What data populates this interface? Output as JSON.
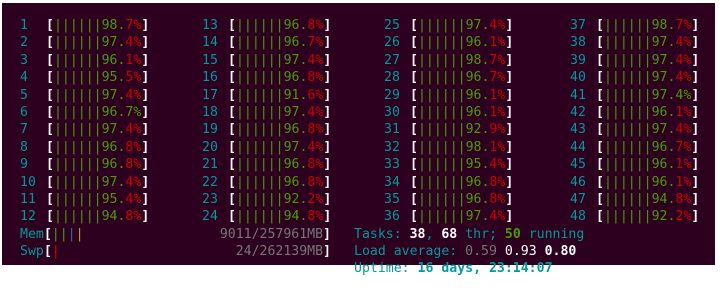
{
  "cpus": [
    {
      "n": "1",
      "bars": "||||||",
      "int": "98.",
      "dec": "7",
      "dec_color": "red"
    },
    {
      "n": "13",
      "bars": "||||||",
      "int": "96.",
      "dec": "8",
      "dec_color": "red"
    },
    {
      "n": "25",
      "bars": "||||||",
      "int": "97.",
      "dec": "4",
      "dec_color": "red"
    },
    {
      "n": "37",
      "bars": "||||||",
      "int": "98.",
      "dec": "7",
      "dec_color": "red"
    },
    {
      "n": "2",
      "bars": "||||||",
      "int": "97.",
      "dec": "4",
      "dec_color": "red"
    },
    {
      "n": "14",
      "bars": "||||||",
      "int": "96.",
      "dec": "7",
      "dec_color": "red"
    },
    {
      "n": "26",
      "bars": "||||||",
      "int": "96.",
      "dec": "1",
      "dec_color": "red"
    },
    {
      "n": "38",
      "bars": "||||||",
      "int": "97.",
      "dec": "4",
      "dec_color": "red"
    },
    {
      "n": "3",
      "bars": "||||||",
      "int": "96.",
      "dec": "1",
      "dec_color": "red"
    },
    {
      "n": "15",
      "bars": "||||||",
      "int": "97.",
      "dec": "4",
      "dec_color": "red"
    },
    {
      "n": "27",
      "bars": "||||||",
      "int": "98.",
      "dec": "7",
      "dec_color": "red"
    },
    {
      "n": "39",
      "bars": "||||||",
      "int": "97.",
      "dec": "4",
      "dec_color": "red"
    },
    {
      "n": "4",
      "bars": "||||||",
      "int": "95.",
      "dec": "5",
      "dec_color": "red"
    },
    {
      "n": "16",
      "bars": "||||||",
      "int": "96.",
      "dec": "8",
      "dec_color": "red"
    },
    {
      "n": "28",
      "bars": "||||||",
      "int": "96.",
      "dec": "7",
      "dec_color": "red"
    },
    {
      "n": "40",
      "bars": "||||||",
      "int": "97.",
      "dec": "4",
      "dec_color": "red"
    },
    {
      "n": "5",
      "bars": "||||||",
      "int": "97.",
      "dec": "4",
      "dec_color": "red"
    },
    {
      "n": "17",
      "bars": "||||||",
      "int": "91.",
      "dec": "6",
      "dec_color": "red"
    },
    {
      "n": "29",
      "bars": "||||||",
      "int": "96.",
      "dec": "1",
      "dec_color": "red"
    },
    {
      "n": "41",
      "bars": "||||||",
      "int": "97.",
      "dec": "4",
      "dec_color": "green"
    },
    {
      "n": "6",
      "bars": "||||||",
      "int": "96.",
      "dec": "7",
      "dec_color": "green"
    },
    {
      "n": "18",
      "bars": "||||||",
      "int": "97.",
      "dec": "4",
      "dec_color": "red"
    },
    {
      "n": "30",
      "bars": "||||||",
      "int": "96.",
      "dec": "1",
      "dec_color": "red"
    },
    {
      "n": "42",
      "bars": "||||||",
      "int": "96.",
      "dec": "1",
      "dec_color": "red"
    },
    {
      "n": "7",
      "bars": "||||||",
      "int": "97.",
      "dec": "4",
      "dec_color": "red"
    },
    {
      "n": "19",
      "bars": "||||||",
      "int": "96.",
      "dec": "8",
      "dec_color": "red"
    },
    {
      "n": "31",
      "bars": "||||||",
      "int": "92.",
      "dec": "9",
      "dec_color": "red"
    },
    {
      "n": "43",
      "bars": "||||||",
      "int": "97.",
      "dec": "4",
      "dec_color": "red"
    },
    {
      "n": "8",
      "bars": "||||||",
      "int": "96.",
      "dec": "8",
      "dec_color": "red"
    },
    {
      "n": "20",
      "bars": "||||||",
      "int": "97.",
      "dec": "4",
      "dec_color": "red"
    },
    {
      "n": "32",
      "bars": "||||||",
      "int": "98.",
      "dec": "1",
      "dec_color": "red"
    },
    {
      "n": "44",
      "bars": "||||||",
      "int": "96.",
      "dec": "7",
      "dec_color": "red"
    },
    {
      "n": "9",
      "bars": "||||||",
      "int": "96.",
      "dec": "8",
      "dec_color": "red"
    },
    {
      "n": "21",
      "bars": "||||||",
      "int": "96.",
      "dec": "8",
      "dec_color": "red"
    },
    {
      "n": "33",
      "bars": "||||||",
      "int": "95.",
      "dec": "4",
      "dec_color": "red"
    },
    {
      "n": "45",
      "bars": "||||||",
      "int": "96.",
      "dec": "1",
      "dec_color": "red"
    },
    {
      "n": "10",
      "bars": "||||||",
      "int": "97.",
      "dec": "4",
      "dec_color": "red"
    },
    {
      "n": "22",
      "bars": "||||||",
      "int": "96.",
      "dec": "8",
      "dec_color": "red"
    },
    {
      "n": "34",
      "bars": "||||||",
      "int": "96.",
      "dec": "8",
      "dec_color": "red"
    },
    {
      "n": "46",
      "bars": "||||||",
      "int": "96.",
      "dec": "1",
      "dec_color": "red"
    },
    {
      "n": "11",
      "bars": "||||||",
      "int": "95.",
      "dec": "4",
      "dec_color": "red"
    },
    {
      "n": "23",
      "bars": "||||||",
      "int": "92.",
      "dec": "2",
      "dec_color": "red"
    },
    {
      "n": "35",
      "bars": "||||||",
      "int": "96.",
      "dec": "8",
      "dec_color": "red"
    },
    {
      "n": "47",
      "bars": "||||||",
      "int": "94.",
      "dec": "8",
      "dec_color": "red"
    },
    {
      "n": "12",
      "bars": "||||||",
      "int": "94.",
      "dec": "8",
      "dec_color": "red"
    },
    {
      "n": "24",
      "bars": "||||||",
      "int": "94.",
      "dec": "8",
      "dec_color": "red"
    },
    {
      "n": "36",
      "bars": "||||||",
      "int": "97.",
      "dec": "4",
      "dec_color": "red"
    },
    {
      "n": "48",
      "bars": "||||||",
      "int": "92.",
      "dec": "2",
      "dec_color": "red"
    }
  ],
  "mem": {
    "label": "Mem",
    "bars_green": "||",
    "bars_blue": "|",
    "bars_yellow": "|",
    "value": "9011/257961MB"
  },
  "swp": {
    "label": "Swp",
    "bars_red": "|",
    "value": "24/262139MB"
  },
  "tasks": {
    "label": "Tasks: ",
    "count": "38",
    "sep": ", ",
    "threads": "68",
    "thr_label": " thr; ",
    "running": "50",
    "running_label": " running"
  },
  "load": {
    "label": "Load average: ",
    "l1": "0.59",
    "l5": "0.93",
    "l15": "0.80"
  },
  "uptime": {
    "label": "Uptime: ",
    "value": "16 days, 23:14:07"
  },
  "colors": {
    "background": "#2c001e",
    "cyan": "#06989a",
    "green": "#4e9a06",
    "red": "#cc0000",
    "yellow": "#c4a000",
    "blue": "#3465a4"
  }
}
